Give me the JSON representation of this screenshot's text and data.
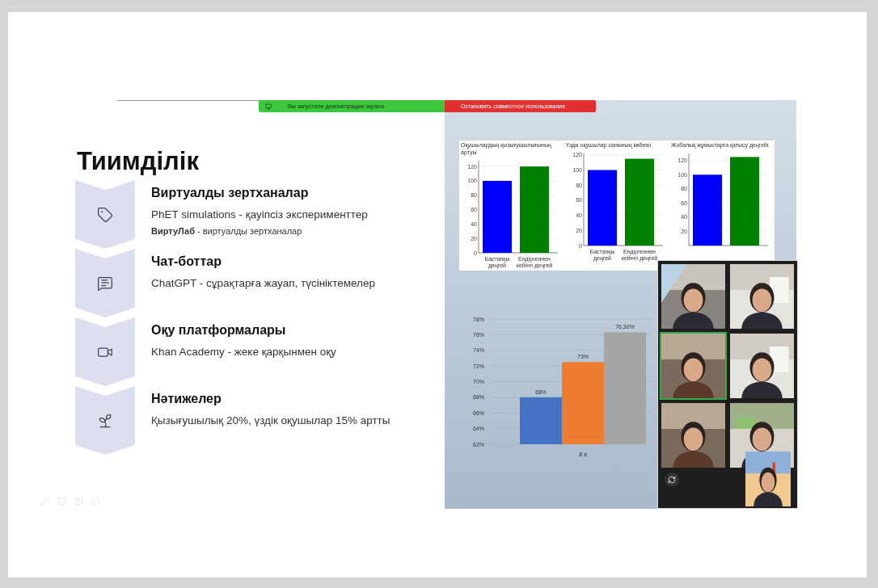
{
  "share_banner": {
    "status": "Вы запустили демонстрацию экрана",
    "stop_button": "Остановить совместное использование"
  },
  "slide": {
    "title": "Тиимділік",
    "items": [
      {
        "kind": "tag",
        "heading": "Виртуалды зертханалар",
        "lines": [
          "PhET simulations - қауіпсіз эксперименттер",
          "**ВиртуЛаб** - виртуалды зертханалар"
        ]
      },
      {
        "kind": "chat",
        "heading": "Чат-боттар",
        "lines": [
          "ChatGPT - сұрақтарға жауап, түсініктемелер"
        ]
      },
      {
        "kind": "video",
        "heading": "Оқу платформалары",
        "lines": [
          "Khan Academy - жеке қарқынмен оқу"
        ]
      },
      {
        "kind": "sprout",
        "heading": "Нәтижелер",
        "lines": [
          "Қызығушылық 20%, үздік оқушылар 15% артты"
        ]
      }
    ]
  },
  "charts": [
    {
      "chart_data": {
        "type": "bar",
        "title": "Оқушылардың қызығушылығының артуы",
        "categories": [
          "Бастапқы деңгей",
          "Ендіргеннен кейінгі деңгей"
        ],
        "series": [
          {
            "color": "#0000ff",
            "values": [
              100,
              null
            ]
          },
          {
            "color": "#008000",
            "values": [
              null,
              120
            ]
          }
        ],
        "ylim": [
          0,
          128
        ],
        "yticks": [
          0,
          20,
          40,
          60,
          80,
          100,
          120
        ],
        "grid": true
      }
    },
    {
      "chart_data": {
        "type": "bar",
        "title": "Үздік оқушылар санының көбеюі",
        "categories": [
          "Бастапқы деңгей",
          "Ендіргеннен кейінгі деңгей"
        ],
        "series": [
          {
            "color": "#0000ff",
            "values": [
              100,
              null
            ]
          },
          {
            "color": "#008000",
            "values": [
              null,
              115
            ]
          }
        ],
        "ylim": [
          0,
          122
        ],
        "yticks": [
          0,
          20,
          40,
          60,
          80,
          100,
          120
        ],
        "grid": true
      }
    },
    {
      "chart_data": {
        "type": "bar",
        "title": "Жобалық жұмыстарға қатысу деңгейі",
        "categories": [
          null,
          null
        ],
        "series": [
          {
            "color": "#0000ff",
            "values": [
              100,
              null
            ]
          },
          {
            "color": "#008000",
            "values": [
              null,
              125
            ]
          }
        ],
        "ylim": [
          0,
          130
        ],
        "yticks": [
          20,
          40,
          60,
          80,
          100,
          120
        ],
        "grid": true
      }
    }
  ],
  "result_chart": {
    "chart_data": {
      "type": "bar",
      "categories": [
        "8 а"
      ],
      "grid": true,
      "series": [
        {
          "color": "#4472c4",
          "values": [
            68
          ]
        },
        {
          "color": "#ed7d31",
          "values": [
            72.5
          ]
        },
        {
          "color": "#a5a5a5",
          "values": [
            76.3
          ]
        }
      ],
      "ylim": [
        62,
        78
      ],
      "yticks": [
        {
          "value": 62,
          "label": "62%"
        },
        {
          "value": 64,
          "label": "64%"
        },
        {
          "value": 66,
          "label": "66%"
        },
        {
          "value": 68,
          "label": "68%"
        },
        {
          "value": 70,
          "label": "70%"
        },
        {
          "value": 72,
          "label": "72%"
        },
        {
          "value": 74,
          "label": "74%"
        },
        {
          "value": 76,
          "label": "76%"
        },
        {
          "value": 78,
          "label": "78%"
        }
      ],
      "value_labels": [
        "68%",
        "73%",
        "76,30%"
      ]
    }
  },
  "video_tiles": [
    {
      "kind": "picture",
      "speaking": false
    },
    {
      "kind": "picture",
      "speaking": false
    },
    {
      "kind": "picture",
      "speaking": true
    },
    {
      "kind": "picture",
      "speaking": false
    },
    {
      "kind": "picture",
      "speaking": false
    },
    {
      "kind": "picture",
      "speaking": false
    }
  ],
  "self_view": {
    "kind": "picture"
  }
}
